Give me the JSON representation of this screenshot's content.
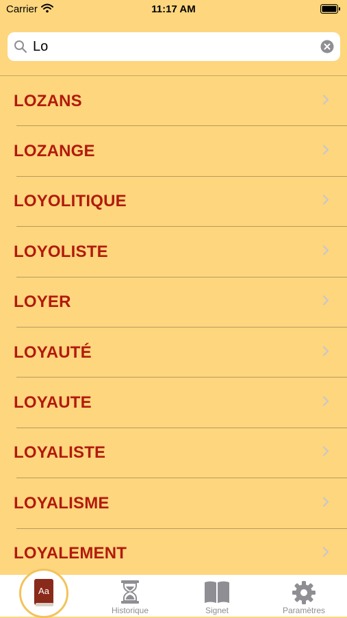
{
  "status_bar": {
    "carrier": "Carrier",
    "time": "11:17 AM"
  },
  "search": {
    "value": "Lo",
    "placeholder": ""
  },
  "results": [
    {
      "label": "LOZANS"
    },
    {
      "label": "LOZANGE"
    },
    {
      "label": "LOYOLITIQUE"
    },
    {
      "label": "LOYOLISTE"
    },
    {
      "label": "LOYER"
    },
    {
      "label": "LOYAUTÉ"
    },
    {
      "label": "LOYAUTE"
    },
    {
      "label": "LOYALISTE"
    },
    {
      "label": "LOYALISME"
    },
    {
      "label": "LOYALEMENT"
    }
  ],
  "tab_bar": {
    "dictionary": {
      "icon": "dictionary-book-icon",
      "icon_text": "Aa",
      "selected": true
    },
    "history": {
      "label": "Historique",
      "icon": "hourglass-icon"
    },
    "bookmarks": {
      "label": "Signet",
      "icon": "open-book-icon"
    },
    "settings": {
      "label": "Paramètres",
      "icon": "gear-icon"
    }
  },
  "colors": {
    "background": "#FDD67E",
    "item_text": "#B21A0C",
    "separator": "#B89A5C",
    "tab_inactive": "#8E8E93",
    "dictionary_book": "#8A2A1A",
    "dictionary_ring": "#F2C35B"
  }
}
